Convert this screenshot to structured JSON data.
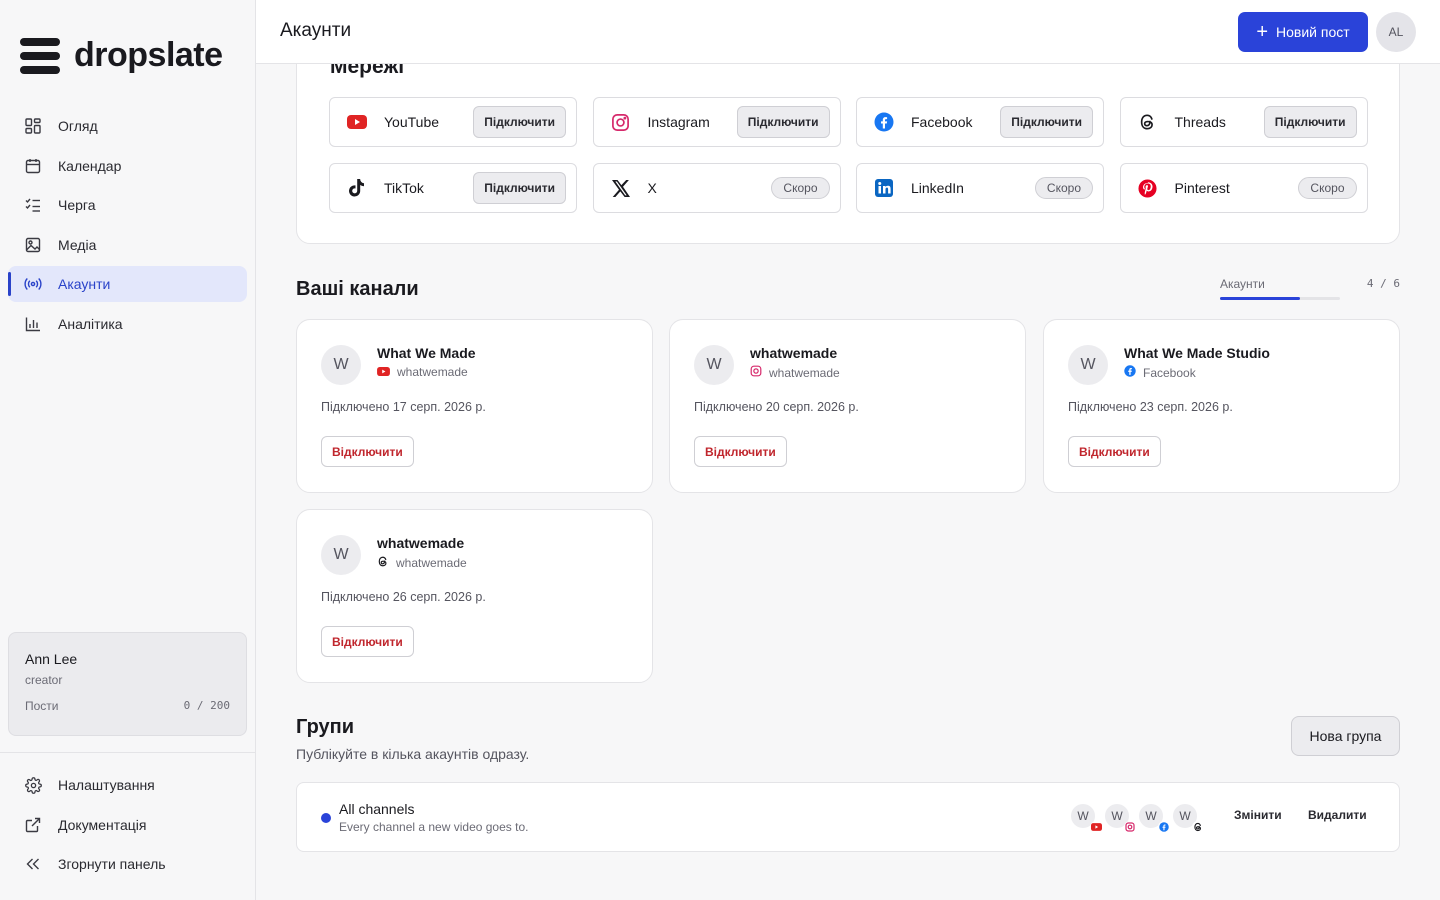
{
  "app": {
    "brand": "dropslate"
  },
  "sidebar": {
    "items": [
      {
        "label": "Огляд"
      },
      {
        "label": "Календар"
      },
      {
        "label": "Черга"
      },
      {
        "label": "Медіа"
      },
      {
        "label": "Акаунти"
      },
      {
        "label": "Аналітика"
      }
    ],
    "user": {
      "name": "Ann Lee",
      "role": "creator",
      "posts_label": "Пости",
      "posts_count": "0 / 200"
    },
    "bottom": [
      {
        "label": "Налаштування"
      },
      {
        "label": "Документація"
      },
      {
        "label": "Згорнути панель"
      }
    ]
  },
  "header": {
    "title": "Акаунти",
    "new_post": "Новий пост",
    "avatar": "AL"
  },
  "networks": {
    "title": "Мережі",
    "items": [
      {
        "name": "YouTube",
        "action": "Підключити"
      },
      {
        "name": "Instagram",
        "action": "Підключити"
      },
      {
        "name": "Facebook",
        "action": "Підключити"
      },
      {
        "name": "Threads",
        "action": "Підключити"
      },
      {
        "name": "TikTok",
        "action": "Підключити"
      },
      {
        "name": "X",
        "action": "Скоро"
      },
      {
        "name": "LinkedIn",
        "action": "Скоро"
      },
      {
        "name": "Pinterest",
        "action": "Скоро"
      }
    ]
  },
  "channels": {
    "title": "Ваші канали",
    "quota_label": "Акаунти",
    "quota_count": "4 / 6",
    "quota_fraction": 0.667,
    "items": [
      {
        "initial": "W",
        "name": "What We Made",
        "sub": "whatwemade",
        "network": "youtube",
        "date": "Підключено 17 серп. 2026 р.",
        "disconnect": "Відключити"
      },
      {
        "initial": "W",
        "name": "whatwemade",
        "sub": "whatwemade",
        "network": "instagram",
        "date": "Підключено 20 серп. 2026 р.",
        "disconnect": "Відключити"
      },
      {
        "initial": "W",
        "name": "What We Made Studio",
        "sub": "Facebook",
        "network": "facebook",
        "date": "Підключено 23 серп. 2026 р.",
        "disconnect": "Відключити"
      },
      {
        "initial": "W",
        "name": "whatwemade",
        "sub": "whatwemade",
        "network": "threads",
        "date": "Підключено 26 серп. 2026 р.",
        "disconnect": "Відключити"
      }
    ]
  },
  "groups": {
    "title": "Групи",
    "subtitle": "Публікуйте в кілька акаунтів одразу.",
    "new_group": "Нова група",
    "items": [
      {
        "name": "All channels",
        "desc": "Every channel a new video goes to.",
        "avatars": [
          "W",
          "W",
          "W",
          "W"
        ],
        "edit": "Змінити",
        "delete": "Видалити"
      }
    ]
  },
  "colors": {
    "accent": "#2a43d9",
    "danger": "#c0262d",
    "youtube": "#e02424",
    "instagram": "#d6296b",
    "facebook": "#1877f2",
    "linkedin": "#0a66c2",
    "pinterest": "#e60023"
  }
}
